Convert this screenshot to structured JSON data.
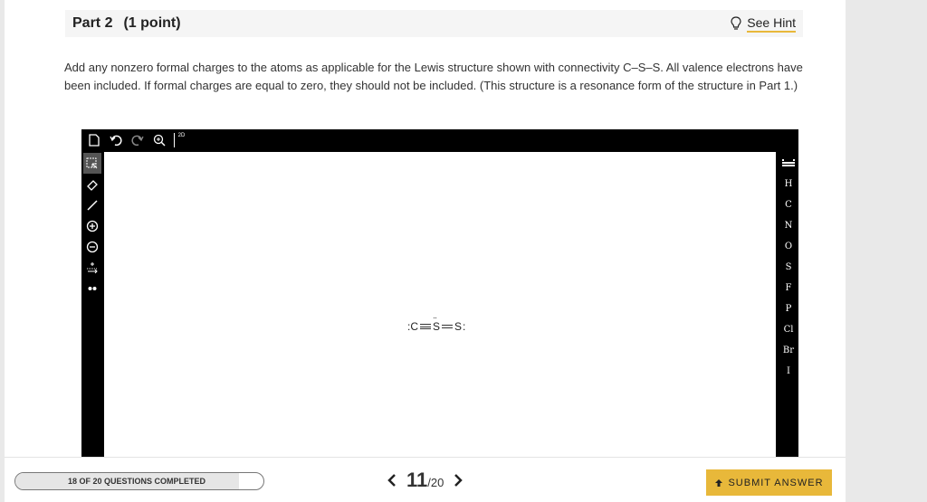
{
  "part": {
    "title": "Part 2",
    "points": "(1 point)",
    "hint_label": "See Hint"
  },
  "question": {
    "text": "Add any nonzero formal charges to the atoms as applicable for the Lewis structure shown with connectivity C–S–S. All valence electrons have been included. If formal charges are equal to zero, they should not be included. (This structure is a resonance form of the structure in Part 1.)"
  },
  "sketcher": {
    "toolbar_icons": [
      "new-document-icon",
      "undo-icon",
      "redo-icon",
      "zoom-icon",
      "2d-clean-icon"
    ],
    "zoom_label": "2D",
    "left_tools": [
      "select-icon",
      "eraser-icon",
      "bond-icon",
      "plus-charge-icon",
      "minus-charge-icon",
      "move-charge-icon",
      "lone-pair-icon"
    ],
    "elements": [
      "H",
      "C",
      "N",
      "O",
      "S",
      "F",
      "P",
      "Cl",
      "Br",
      "I"
    ],
    "molecule": {
      "atoms": [
        "C",
        "S",
        "S"
      ]
    }
  },
  "footer": {
    "progress_text": "18 OF 20 QUESTIONS COMPLETED",
    "progress_fraction": 0.9,
    "current_page": "11",
    "total_pages": "/20",
    "submit_label": "SUBMIT ANSWER"
  },
  "colors": {
    "accent": "#e8b83a",
    "sketcher_bg": "#000000"
  }
}
